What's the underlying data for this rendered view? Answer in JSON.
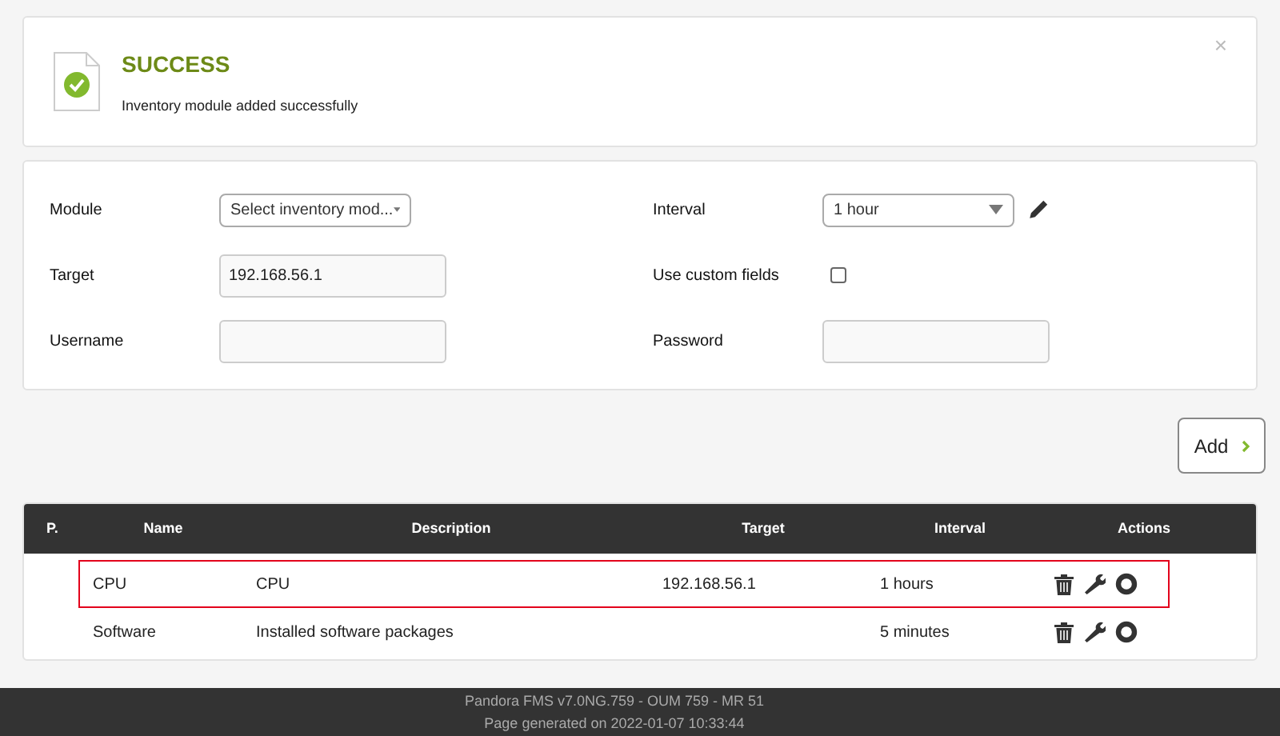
{
  "message": {
    "title": "SUCCESS",
    "text": "Inventory module added successfully",
    "close": "×"
  },
  "form": {
    "fields": [
      {
        "kind": "select",
        "label": "Module",
        "value": "Select inventory mod..."
      },
      {
        "kind": "select-edit",
        "label": "Interval",
        "value": "1 hour"
      },
      {
        "kind": "text",
        "label": "Target",
        "value": "192.168.56.1"
      },
      {
        "kind": "checkbox",
        "label": "Use custom fields",
        "checked": false
      },
      {
        "kind": "text",
        "label": "Username"
      },
      {
        "kind": "password",
        "label": "Password"
      }
    ]
  },
  "add_button": {
    "label": "Add"
  },
  "table": {
    "columns": [
      "P.",
      "Name",
      "Description",
      "Target",
      "Interval",
      "Actions"
    ],
    "rows": [
      {
        "name": "CPU",
        "description": "CPU",
        "target": "192.168.56.1",
        "interval": "1 hours",
        "selected": true
      },
      {
        "name": "Software",
        "description": "Installed software packages",
        "interval": "5 minutes",
        "selected": false
      }
    ]
  },
  "footer": {
    "lines": [
      "Pandora FMS v7.0NG.759 - OUM 759 - MR 51",
      "Page generated on 2022-01-07 10:33:44"
    ]
  }
}
